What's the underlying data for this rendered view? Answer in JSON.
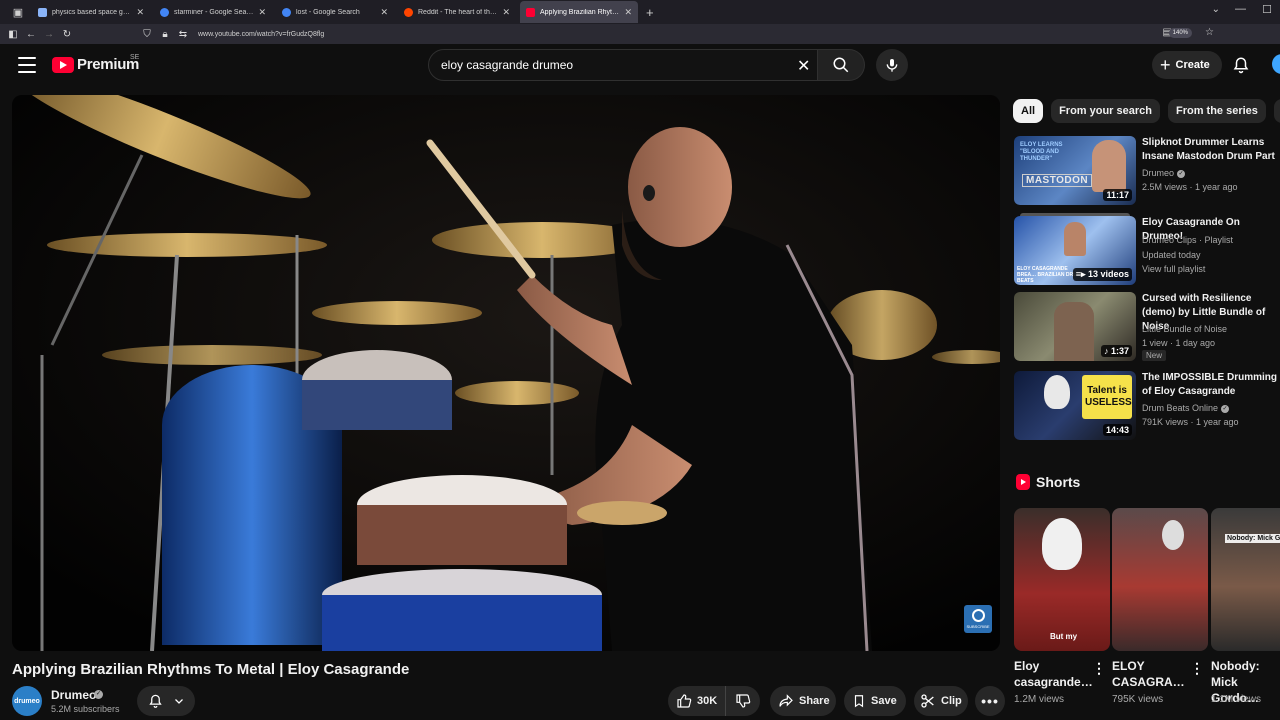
{
  "browser": {
    "tabs": [
      {
        "label": "physics based space games - G",
        "active": false,
        "favicon_color": "#8ab4f8"
      },
      {
        "label": "starminer - Google Search",
        "active": false,
        "favicon_color": "#4285f4"
      },
      {
        "label": "lost - Google Search",
        "active": false,
        "favicon_color": "#4285f4"
      },
      {
        "label": "Reddit - The heart of the intern",
        "active": false,
        "favicon_color": "#ff4500"
      },
      {
        "label": "Applying Brazilian Rhythms",
        "active": true,
        "favicon_color": "#ff0033"
      }
    ],
    "url": "www.youtube.com/watch?v=frGudzQ8flg",
    "zoom": "140%"
  },
  "header": {
    "logo_text": "Premium",
    "region": "SE",
    "search_value": "eloy casagrande drumeo",
    "create_label": "Create"
  },
  "video": {
    "title": "Applying Brazilian Rhythms To Metal | Eloy Casagrande",
    "watermark": "SUBSCRIBE",
    "channel": {
      "name": "Drumeo",
      "subscribers": "5.2M subscribers",
      "avatar_text": "drumeo"
    },
    "actions": {
      "likes": "30K",
      "share": "Share",
      "save": "Save",
      "clip": "Clip"
    }
  },
  "sidebar": {
    "chips": [
      "All",
      "From your search",
      "From the series",
      "Fr"
    ],
    "recommendations": [
      {
        "title": "Slipknot Drummer Learns Insane Mastodon Drum Part",
        "channel": "Drumeo",
        "verified": true,
        "meta": "2.5M views · 1 year ago",
        "duration": "11:17",
        "thumb_text": "MASTODON",
        "thumb_sub": "ELOY LEARNS \"BLOOD AND THUNDER\""
      },
      {
        "title": "Eloy Casagrande On Drumeo!",
        "channel": "Drumeo Clips · Playlist",
        "meta": "Updated today",
        "meta2": "View full playlist",
        "duration": "13 videos",
        "thumb_text": "ELOY CASAGRANDE BREA… BRAZILIAN DRUM BEATS"
      },
      {
        "title": "Cursed with Resilience (demo) by Little Bundle of Noise",
        "channel": "Little Bundle of Noise",
        "meta": "1 view · 1 day ago",
        "duration": "1:37",
        "badge": "New"
      },
      {
        "title": "The IMPOSSIBLE Drumming of Eloy Casagrande",
        "channel": "Drum Beats Online",
        "verified": true,
        "meta": "791K views · 1 year ago",
        "duration": "14:43",
        "thumb_text": "Talent is USELESS"
      }
    ],
    "shorts": {
      "heading": "Shorts",
      "items": [
        {
          "title": "Eloy casagrande…",
          "views": "1.2M views",
          "caption": "But my"
        },
        {
          "title": "ELOY CASAGRA…",
          "views": "795K views",
          "caption": ""
        },
        {
          "title": "Nobody: Mick Gordo…",
          "views": "1.1M views",
          "caption": "Nobody: Mick Gor"
        }
      ]
    }
  }
}
